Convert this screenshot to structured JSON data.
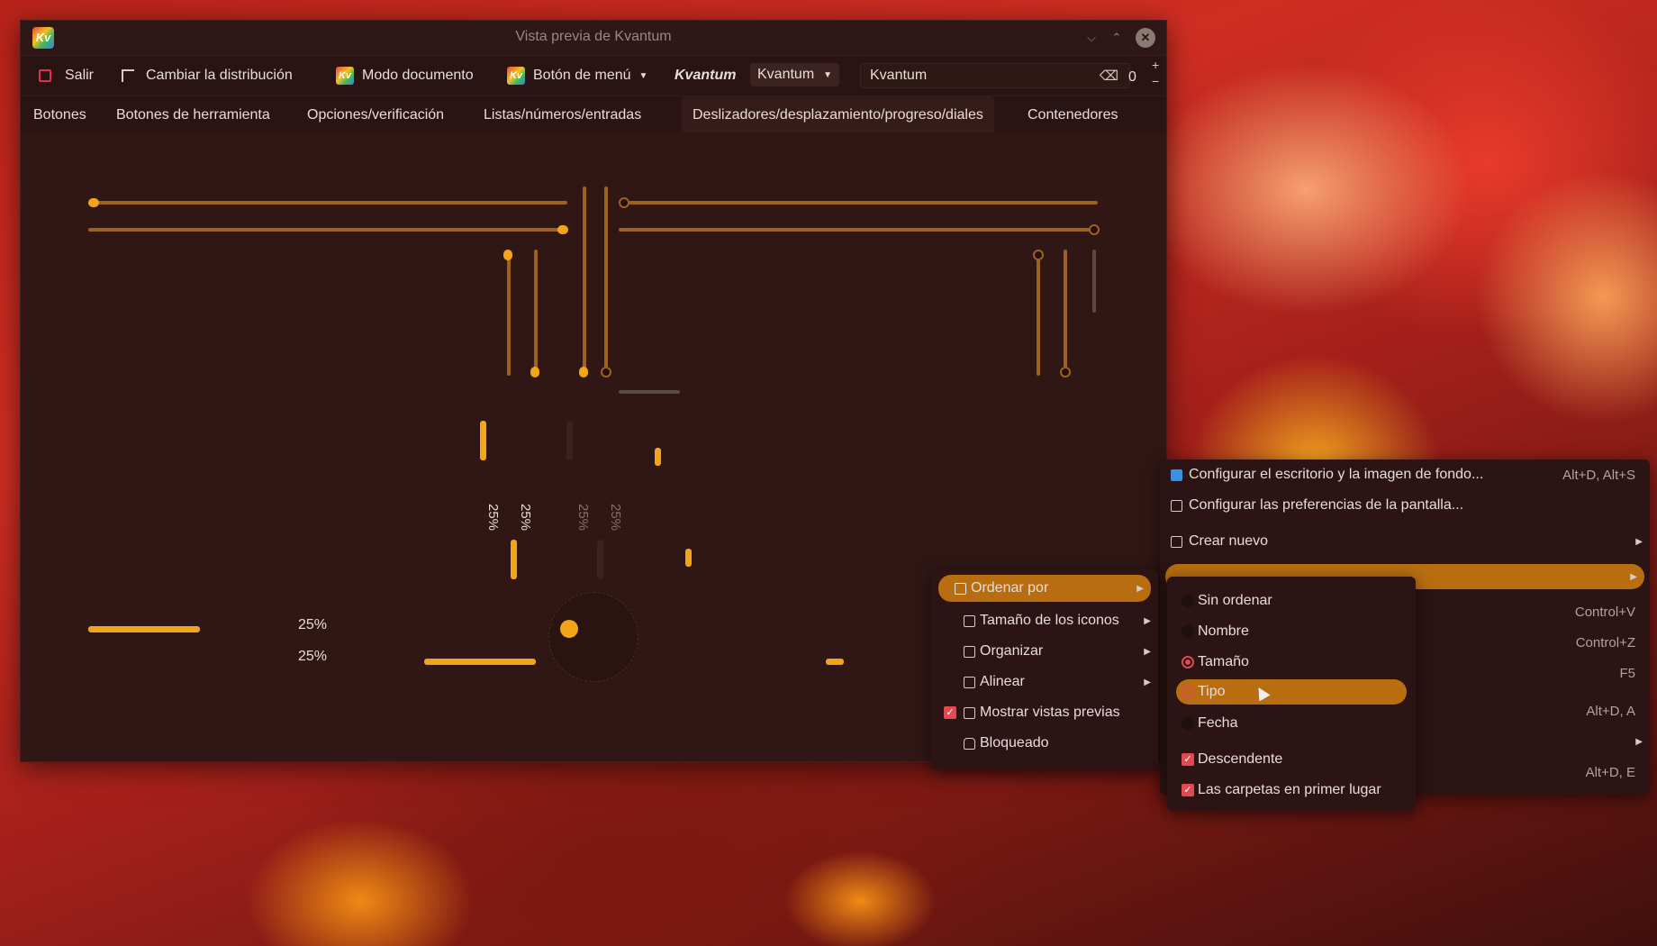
{
  "window": {
    "title": "Vista previa de Kvantum",
    "logo_text": "Kv",
    "controls": {
      "minimize": "⌵",
      "maximize": "⌃",
      "close": "✕"
    }
  },
  "toolbar": {
    "exit_label": "Salir",
    "layout_label": "Cambiar la distribución",
    "docmode_label": "Modo documento",
    "menubutton_label": "Botón de menú",
    "italic_label": "Kvantum",
    "combo_value": "Kvantum",
    "line_edit_value": "Kvantum",
    "spin_value": "0",
    "spin_plus": "+",
    "spin_minus": "−"
  },
  "tabs": [
    {
      "label": "Botones"
    },
    {
      "label": "Botones de herramienta"
    },
    {
      "label": "Opciones/verificación"
    },
    {
      "label": "Listas/números/entradas"
    },
    {
      "label": "Deslizadores/desplazamiento/progreso/diales"
    },
    {
      "label": "Contenedores"
    }
  ],
  "progress": {
    "vertical_labels": [
      "25%",
      "25%",
      "25%",
      "25%"
    ],
    "horizontal_labels": [
      "25%",
      "25%"
    ],
    "value_percent": 25
  },
  "desktop_menu": {
    "items": [
      {
        "label": "Configurar el escritorio y la imagen de fondo...",
        "shortcut": "Alt+D, Alt+S",
        "icon": "desktop-icon"
      },
      {
        "label": "Configurar las preferencias de la pantalla...",
        "shortcut": "",
        "icon": "display-icon"
      },
      {
        "label": "Crear nuevo",
        "shortcut": "",
        "icon": "new-file-icon"
      }
    ],
    "hidden_shortcuts": [
      "Control+V",
      "Control+Z",
      "F5",
      "Alt+D, A",
      "Alt+D, E"
    ]
  },
  "view_menu": {
    "items": [
      {
        "label": "Ordenar por"
      },
      {
        "label": "Tamaño de los iconos"
      },
      {
        "label": "Organizar"
      },
      {
        "label": "Alinear"
      },
      {
        "label": "Mostrar vistas previas"
      },
      {
        "label": "Bloqueado"
      }
    ]
  },
  "sort_menu": {
    "items": [
      {
        "label": "Sin ordenar"
      },
      {
        "label": "Nombre"
      },
      {
        "label": "Tamaño"
      },
      {
        "label": "Tipo"
      },
      {
        "label": "Fecha"
      },
      {
        "label": "Descendente"
      },
      {
        "label": "Las carpetas en primer lugar"
      }
    ]
  },
  "colors": {
    "accent": "#f2a516",
    "highlight": "#b86e10",
    "check": "#e24a52",
    "window_bg": "#2a1413"
  }
}
